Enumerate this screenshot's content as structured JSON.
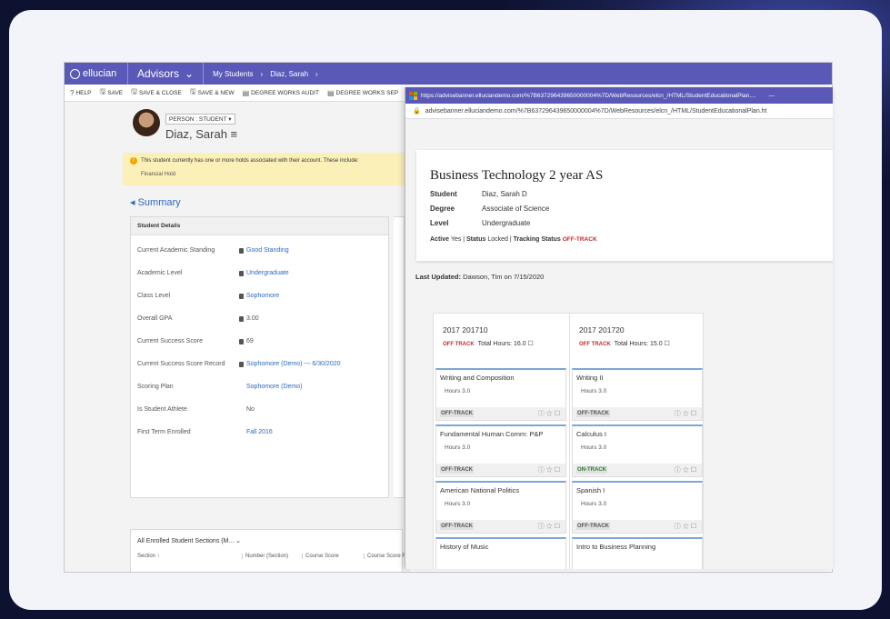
{
  "colors": {
    "brand": "#5b59b8",
    "link": "#2a6bbf",
    "off_track": "#c62828",
    "on_track": "#2e7d32",
    "hold_bg": "#fbf1b8"
  },
  "app": {
    "brand": "ellucian",
    "module": "Advisors",
    "breadcrumb": [
      "My Students",
      "Diaz, Sarah"
    ]
  },
  "commands": [
    "HELP",
    "SAVE",
    "SAVE & CLOSE",
    "SAVE & NEW",
    "DEGREE WORKS AUDIT",
    "DEGREE WORKS SEP"
  ],
  "person": {
    "type": "PERSON : STUDENT",
    "name": "Diaz, Sarah"
  },
  "hold": {
    "message": "This student currently has one or more holds associated with their account. These include:",
    "item": "Financial Hold"
  },
  "summary_label": "Summary",
  "student_details": {
    "header": "Student Details",
    "rows": [
      {
        "label": "Current Academic Standing",
        "value": "Good Standing"
      },
      {
        "label": "Academic Level",
        "value": "Undergraduate"
      },
      {
        "label": "Class Level",
        "value": "Sophomore"
      },
      {
        "label": "Overall GPA",
        "value": "3.00"
      },
      {
        "label": "Current Success Score",
        "value": "69"
      },
      {
        "label": "Current Success Score Record",
        "value": "Sophomore (Demo) --- 6/30/2020"
      },
      {
        "label": "Scoring Plan",
        "value": "Sophomore (Demo)"
      },
      {
        "label": "Is Student Athlete",
        "value": "No"
      },
      {
        "label": "First Term Enrolled",
        "value": "Fall 2016"
      }
    ]
  },
  "enrolled": {
    "header": "All Enrolled Student Sections (M...",
    "columns": [
      "Section ↑",
      "Number (Section)",
      "Course Score",
      "Course Score Re"
    ]
  },
  "popup": {
    "window_title": "https://advisebanner.elluciandemo.com/%7B637296439650000004%7D/WebResources/elcn_/HTML/StudentEducationalPlan....",
    "url": "advisebanner.elluciandemo.com/%7B637296439650000004%7D/WebResources/elcn_/HTML/StudentEducationalPlan.ht",
    "plan_title": "Business Technology 2 year AS",
    "fields": [
      {
        "label": "Student",
        "value": "Diaz, Sarah D"
      },
      {
        "label": "Degree",
        "value": "Associate of Science"
      },
      {
        "label": "Level",
        "value": "Undergraduate"
      }
    ],
    "active_label": "Active",
    "active_value": "Yes",
    "status_label": "Status",
    "status_value": "Locked",
    "tracking_label": "Tracking Status",
    "tracking_value": "OFF-TRACK",
    "updated_label": "Last Updated:",
    "updated_value": "Dawson, Tim  on  7/15/2020"
  },
  "terms": [
    {
      "name": "2017 201710",
      "status": "OFF TRACK",
      "hours": "Total Hours: 16.0",
      "courses": [
        {
          "name": "Writing and Composition",
          "hours": "Hours 3.0",
          "status": "OFF-TRACK"
        },
        {
          "name": "Fundamental Human Comm: P&P",
          "hours": "Hours 3.0",
          "status": "OFF-TRACK"
        },
        {
          "name": "American National Politics",
          "hours": "Hours 3.0",
          "status": "OFF-TRACK"
        },
        {
          "name": "History of Music",
          "hours": "",
          "status": ""
        }
      ]
    },
    {
      "name": "2017 201720",
      "status": "OFF TRACK",
      "hours": "Total Hours: 15.0",
      "courses": [
        {
          "name": "Writing II",
          "hours": "Hours 3.0",
          "status": "OFF-TRACK"
        },
        {
          "name": "Calculus I",
          "hours": "Hours 3.0",
          "status": "ON-TRACK"
        },
        {
          "name": "Spanish I",
          "hours": "Hours 3.0",
          "status": "OFF-TRACK"
        },
        {
          "name": "Intro to Business Planning",
          "hours": "",
          "status": ""
        }
      ]
    }
  ]
}
